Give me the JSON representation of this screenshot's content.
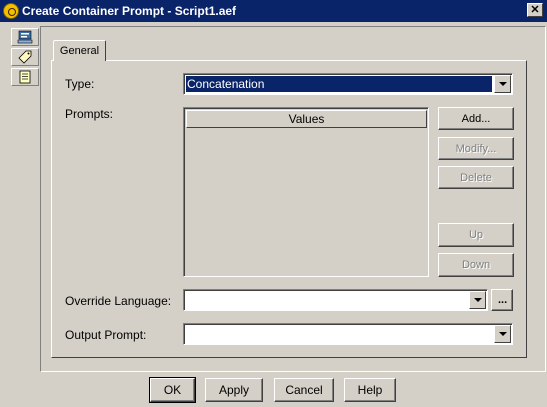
{
  "window": {
    "title": "Create Container Prompt - Script1.aef",
    "close_glyph": "✕"
  },
  "side_icons": [
    "properties-icon",
    "tag-icon",
    "document-icon"
  ],
  "tabs": [
    {
      "label": "General"
    }
  ],
  "form": {
    "type_label": "Type:",
    "type_value": "Concatenation",
    "prompts_label": "Prompts:",
    "prompts_column_header": "Values",
    "override_language_label": "Override Language:",
    "override_language_value": "",
    "browse_glyph": "...",
    "output_prompt_label": "Output Prompt:",
    "output_prompt_value": ""
  },
  "prompt_buttons": {
    "add": "Add...",
    "modify": "Modify...",
    "delete": "Delete",
    "up": "Up",
    "down": "Down"
  },
  "dialog_buttons": {
    "ok": "OK",
    "apply": "Apply",
    "cancel": "Cancel",
    "help": "Help"
  },
  "colors": {
    "titlebar": "#0a246a",
    "face": "#d4d0c8",
    "selection": "#0a246a"
  }
}
